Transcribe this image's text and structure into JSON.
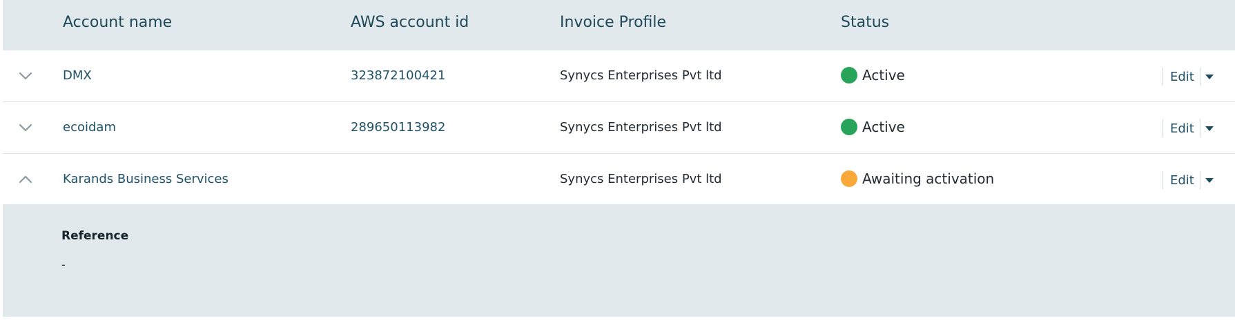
{
  "table": {
    "headers": {
      "account_name": "Account name",
      "aws_account_id": "AWS account id",
      "invoice_profile": "Invoice Profile",
      "status": "Status"
    },
    "rows": [
      {
        "account_name": "DMX",
        "aws_account_id": "323872100421",
        "invoice_profile": "Synycs Enterprises Pvt ltd",
        "status": "Active",
        "status_color": "#27a35a",
        "expanded": false,
        "edit_label": "Edit",
        "chevron_icon": "chevron-down-icon"
      },
      {
        "account_name": "ecoidam",
        "aws_account_id": "289650113982",
        "invoice_profile": "Synycs Enterprises Pvt ltd",
        "status": "Active",
        "status_color": "#27a35a",
        "expanded": false,
        "edit_label": "Edit",
        "chevron_icon": "chevron-down-icon"
      },
      {
        "account_name": "Karands Business Services",
        "aws_account_id": "",
        "invoice_profile": "Synycs Enterprises Pvt ltd",
        "status": "Awaiting activation",
        "status_color": "#f9a83a",
        "expanded": true,
        "edit_label": "Edit",
        "chevron_icon": "chevron-up-icon"
      }
    ],
    "expanded_detail": {
      "reference_label": "Reference",
      "reference_value": "-"
    }
  },
  "colors": {
    "header_bg": "#e1e9ec",
    "link_text": "#1f5268",
    "active": "#27a35a",
    "awaiting": "#f9a83a"
  }
}
